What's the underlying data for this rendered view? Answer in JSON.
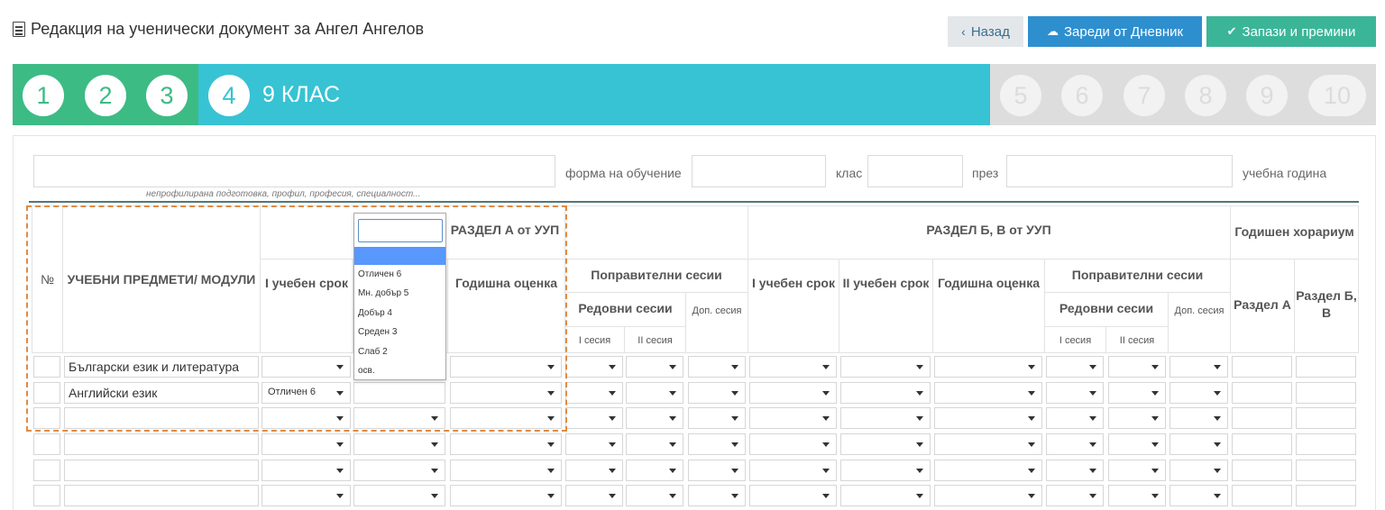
{
  "header": {
    "title": "Редакция на ученически документ за Ангел Ангелов",
    "back_label": "Назад",
    "load_label": "Зареди от Дневник",
    "save_label": "Запази и премини"
  },
  "stepper": {
    "steps": [
      "1",
      "2",
      "3",
      "4",
      "5",
      "6",
      "7",
      "8",
      "9",
      "10"
    ],
    "active_label": "9 КЛАС",
    "colors": {
      "done": "#3dbb85",
      "active": "#37c3d3",
      "todo": "#dddddd"
    }
  },
  "form": {
    "hint": "непрофилирана подготовка, профил, професия, специалност...",
    "label_form": "форма на обучение",
    "label_class": "клас",
    "label_through": "през",
    "label_year": "учебна година"
  },
  "table": {
    "h_no": "№",
    "h_subjects": "УЧЕБНИ ПРЕДМЕТИ/ МОДУЛИ",
    "h_section_a": "РАЗДЕЛ А от УУП",
    "h_section_bv": "РАЗДЕЛ Б, В от УУП",
    "h_annual_hours": "Годишен хорариум",
    "h_term1": "I учебен срок",
    "h_term2": "II учебен срок",
    "h_annual_grade": "Годишна оценка",
    "h_corrective": "Поправителни сесии",
    "h_regular": "Редовни сесии",
    "h_extra": "Доп. сесия",
    "h_s1": "I сесия",
    "h_s2": "II сесия",
    "h_sec_a": "Раздел А",
    "h_sec_bv": "Раздел Б, В",
    "rows": [
      {
        "subject": "Български език и литература",
        "term1": ""
      },
      {
        "subject": "Английски език",
        "term1": "Отличен 6"
      },
      {
        "subject": "",
        "term1": ""
      },
      {
        "subject": "",
        "term1": ""
      },
      {
        "subject": "",
        "term1": ""
      },
      {
        "subject": "",
        "term1": ""
      }
    ]
  },
  "dropdown": {
    "options": [
      "Отличен 6",
      "Мн. добър 5",
      "Добър 4",
      "Среден 3",
      "Слаб 2",
      "осв."
    ],
    "highlight_color": "#5897fb"
  }
}
